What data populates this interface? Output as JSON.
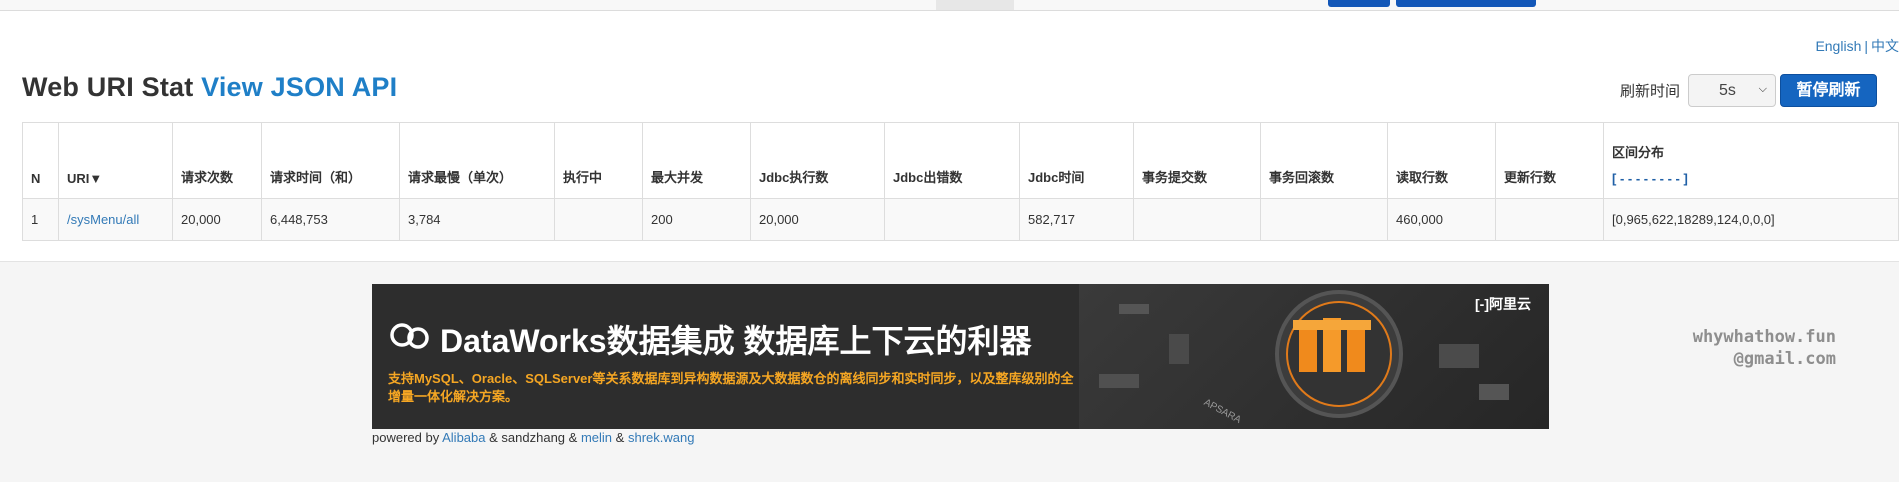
{
  "lang": {
    "english": "English",
    "separator": "|",
    "chinese": "中文"
  },
  "title": {
    "text": "Web URI Stat",
    "link": "View JSON API"
  },
  "refresh": {
    "label": "刷新时间",
    "value": "5s",
    "pause_button": "暂停刷新"
  },
  "table": {
    "headers": [
      "N",
      "URI▼",
      "请求次数",
      "请求时间（和）",
      "请求最慢（单次）",
      "执行中",
      "最大并发",
      "Jdbc执行数",
      "Jdbc出错数",
      "Jdbc时间",
      "事务提交数",
      "事务回滚数",
      "读取行数",
      "更新行数"
    ],
    "distribution_header": "区间分布",
    "distribution_sub": "[ - - - - - - - - ]",
    "rows": [
      {
        "n": "1",
        "uri": "/sysMenu/all",
        "request_count": "20,000",
        "request_time_sum": "6,448,753",
        "request_slowest": "3,784",
        "running": "",
        "max_concurrent": "200",
        "jdbc_exec": "20,000",
        "jdbc_error": "",
        "jdbc_time": "582,717",
        "tx_commit": "",
        "tx_rollback": "",
        "fetch_rows": "460,000",
        "update_rows": "",
        "histogram": "[0,965,622,18289,124,0,0,0]"
      }
    ]
  },
  "banner": {
    "title": "DataWorks数据集成 数据库上下云的利器",
    "text": "支持MySQL、Oracle、SQLServer等关系数据库到异构数据源及大数据数仓的离线同步和实时同步，以及整库级别的全增量一体化解决方案。",
    "logo": "阿里云",
    "apsara": "APSARA"
  },
  "powered": {
    "prefix": "powered by",
    "alibaba": "Alibaba",
    "amp1": "&",
    "sandzhang": "sandzhang",
    "amp2": "&",
    "melin": "melin",
    "amp3": "&",
    "shrek": "shrek.wang"
  },
  "watermark": {
    "line1": "whywhathow.fun",
    "line2": "@gmail.com"
  },
  "colors": {
    "link": "#337ab7",
    "primary_button": "#1565c0",
    "banner_accent": "#f5a623"
  }
}
